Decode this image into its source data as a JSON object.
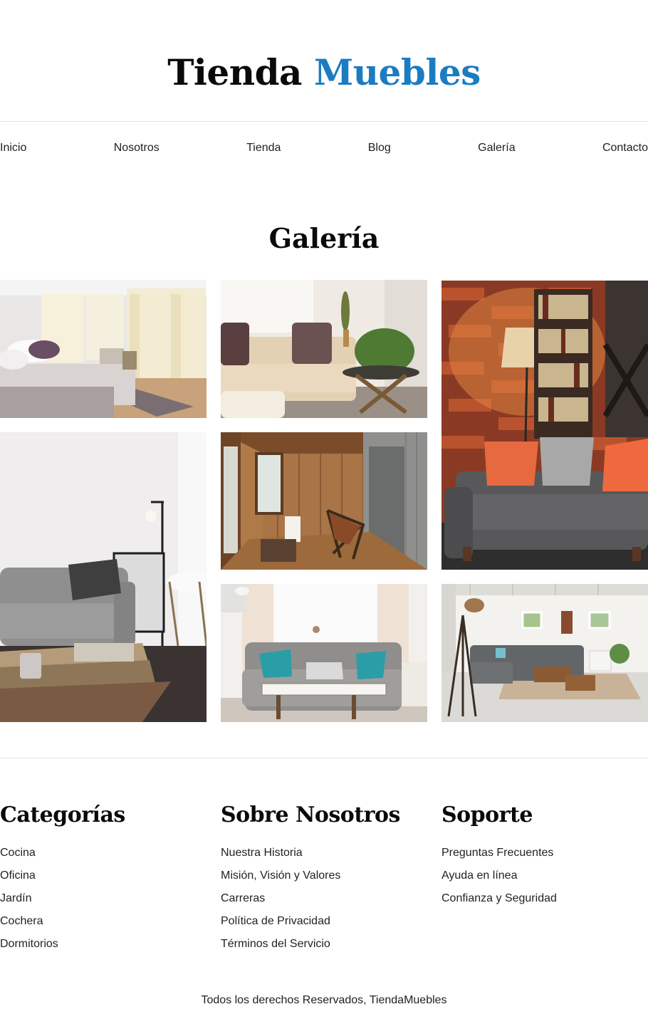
{
  "header": {
    "logo_part1": "Tienda",
    "logo_part2": "Muebles",
    "accent_color": "#1b7cc2"
  },
  "nav": {
    "items": [
      {
        "label": "Inicio"
      },
      {
        "label": "Nosotros"
      },
      {
        "label": "Tienda"
      },
      {
        "label": "Blog"
      },
      {
        "label": "Galería"
      },
      {
        "label": "Contacto"
      }
    ]
  },
  "gallery": {
    "title": "Galería",
    "photos": [
      {
        "subject": "bright bedroom"
      },
      {
        "subject": "beige sofa living room"
      },
      {
        "subject": "grey sofa with bookshelves and lamp"
      },
      {
        "subject": "grey sofa with coffee table"
      },
      {
        "subject": "wooden sunroom with chair"
      },
      {
        "subject": "grey tufted sofa"
      },
      {
        "subject": "open living room with sectional"
      }
    ]
  },
  "footer": {
    "columns": [
      {
        "title": "Categorías",
        "links": [
          "Cocina",
          "Oficina",
          "Jardín",
          "Cochera",
          "Dormitorios"
        ]
      },
      {
        "title": "Sobre Nosotros",
        "links": [
          "Nuestra Historia",
          "Misión, Visión y Valores",
          "Carreras",
          "Política de Privacidad",
          "Términos del Servicio"
        ]
      },
      {
        "title": "Soporte",
        "links": [
          "Preguntas Frecuentes",
          "Ayuda en línea",
          "Confianza y Seguridad"
        ]
      }
    ],
    "copyright": "Todos los derechos Reservados, TiendaMuebles"
  }
}
